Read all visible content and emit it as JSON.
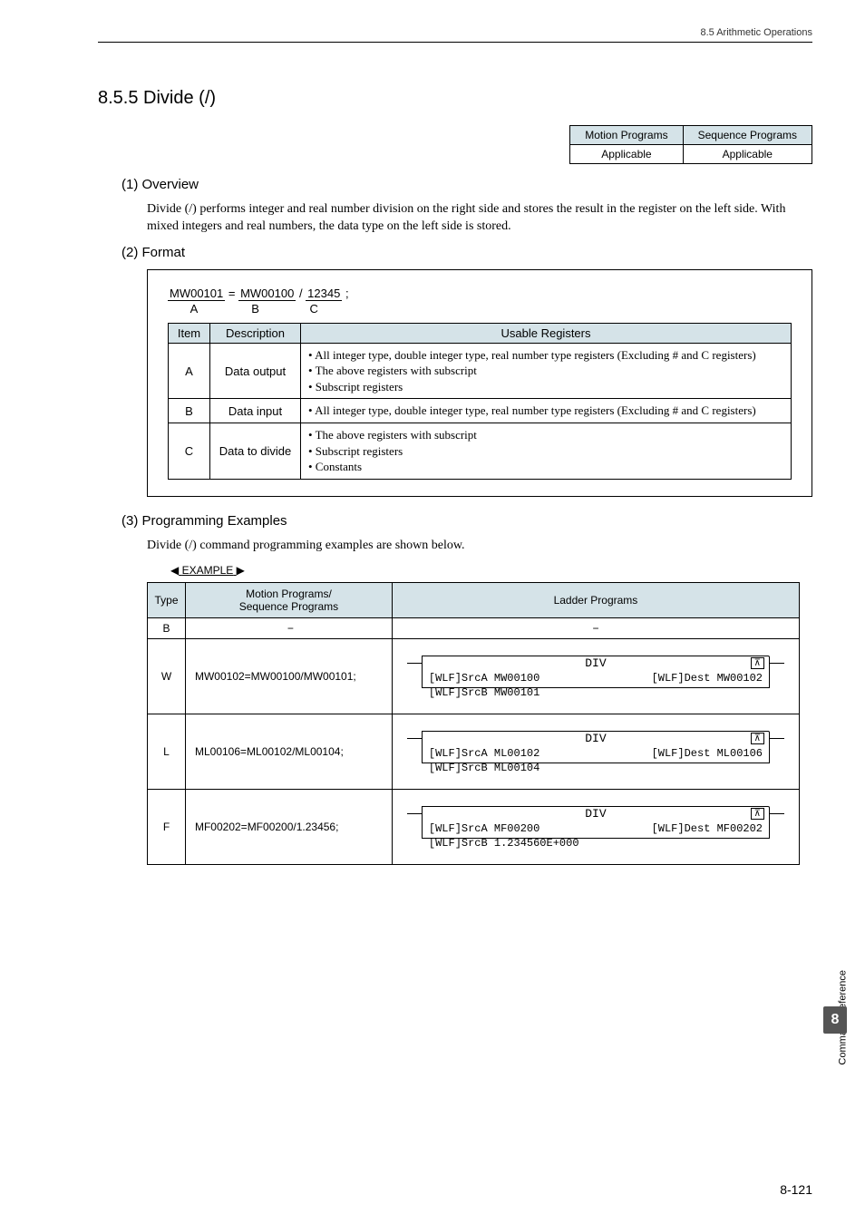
{
  "header": {
    "breadcrumb": "8.5  Arithmetic Operations"
  },
  "section": {
    "number_title": "8.5.5  Divide (/)"
  },
  "applicable": {
    "col1_head": "Motion Programs",
    "col2_head": "Sequence Programs",
    "col1_val": "Applicable",
    "col2_val": "Applicable"
  },
  "subsections": {
    "overview_title": "(1) Overview",
    "overview_text": "Divide (/) performs integer and real number division on the right side and stores the result in the register on the left side. With mixed integers and real numbers, the data type on the left side is stored.",
    "format_title": "(2) Format",
    "examples_title": "(3) Programming Examples",
    "examples_intro": "Divide (/) command programming examples are shown below."
  },
  "format": {
    "expr_a": "MW00101",
    "expr_eq": " = ",
    "expr_b": "MW00100",
    "expr_op": "  /  ",
    "expr_c": "12345",
    "expr_semi": " ;",
    "label_a": "A",
    "label_b": "B",
    "label_c": "C",
    "head_item": "Item",
    "head_desc": "Description",
    "head_usable": "Usable Registers",
    "rows": [
      {
        "item": "A",
        "desc": "Data output",
        "usable": "• All integer type, double integer type, real number type registers (Excluding # and C registers)\n• The above registers with subscript\n• Subscript registers"
      },
      {
        "item": "B",
        "desc": "Data input",
        "usable": "• All integer type, double integer type, real number type registers (Excluding # and C registers)"
      },
      {
        "item": "C",
        "desc": "Data to divide",
        "usable": "• The above registers with subscript\n• Subscript registers\n• Constants"
      }
    ]
  },
  "example_marker": {
    "left": "◀",
    "text": "EXAMPLE",
    "right": "▶"
  },
  "examples": {
    "head_type": "Type",
    "head_prog": "Motion Programs/\nSequence Programs",
    "head_ladder": "Ladder Programs",
    "rows": [
      {
        "type": "B",
        "prog": "−",
        "ladder": null
      },
      {
        "type": "W",
        "prog": "MW00102=MW00100/MW00101;",
        "ladder": {
          "title": "DIV",
          "srcA": "[WLF]SrcA MW00100",
          "dest": "[WLF]Dest MW00102",
          "srcB": "[WLF]SrcB MW00101"
        }
      },
      {
        "type": "L",
        "prog": "ML00106=ML00102/ML00104;",
        "ladder": {
          "title": "DIV",
          "srcA": "[WLF]SrcA ML00102",
          "dest": "[WLF]Dest ML00106",
          "srcB": "[WLF]SrcB ML00104"
        }
      },
      {
        "type": "F",
        "prog": "MF00202=MF00200/1.23456;",
        "ladder": {
          "title": "DIV",
          "srcA": "[WLF]SrcA MF00200",
          "dest": "[WLF]Dest MF00202",
          "srcB": "[WLF]SrcB 1.234560E+000"
        }
      }
    ]
  },
  "sidebar": {
    "label": "Command Reference",
    "chapter": "8"
  },
  "page_number": "8-121"
}
